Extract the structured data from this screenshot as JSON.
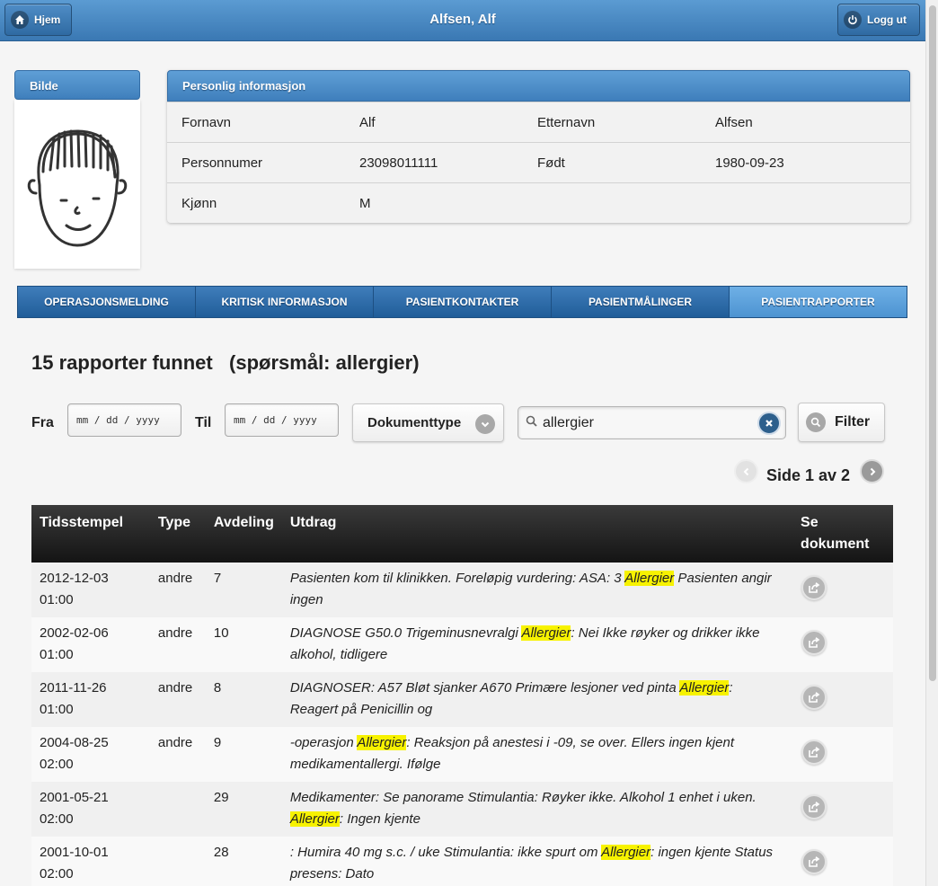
{
  "header": {
    "home_label": "Hjem",
    "title": "Alfsen, Alf",
    "logout_label": "Logg ut"
  },
  "photo_panel": {
    "title": "Bilde"
  },
  "info_panel": {
    "title": "Personlig informasjon",
    "rows": [
      [
        "Fornavn",
        "Alf",
        "Etternavn",
        "Alfsen"
      ],
      [
        "Personnumer",
        "23098011111",
        "Født",
        "1980-09-23"
      ],
      [
        "Kjønn",
        "M",
        "",
        ""
      ]
    ]
  },
  "tabs": [
    {
      "label": "OPERASJONSMELDING",
      "active": false
    },
    {
      "label": "KRITISK INFORMASJON",
      "active": false
    },
    {
      "label": "PASIENTKONTAKTER",
      "active": false
    },
    {
      "label": "PASIENTMÅLINGER",
      "active": false
    },
    {
      "label": "PASIENTRAPPORTER",
      "active": true
    }
  ],
  "results_title": "15 rapporter funnet   (spørsmål: allergier)",
  "filters": {
    "from_label": "Fra",
    "from_value": "mm / dd / yyyy",
    "to_label": "Til",
    "to_value": "mm / dd / yyyy",
    "doctype_label": "Dokumenttype",
    "search_value": "allergier",
    "filter_label": "Filter"
  },
  "pager": {
    "text": "Side 1 av 2"
  },
  "table": {
    "headers": [
      "Tidsstempel",
      "Type",
      "Avdeling",
      "Utdrag",
      "Se dokument"
    ],
    "highlight": "Allergier",
    "rows": [
      {
        "date": "2012-12-03",
        "time": "01:00",
        "type": "andre",
        "dept": "7",
        "pre": "Pasienten kom til klinikken. Foreløpig vurdering: ASA: 3 ",
        "post": " Pasienten angir ingen"
      },
      {
        "date": "2002-02-06",
        "time": "01:00",
        "type": "andre",
        "dept": "10",
        "pre": "DIAGNOSE G50.0 Trigeminusnevralgi ",
        "post": ": Nei Ikke røyker og drikker ikke alkohol, tidligere"
      },
      {
        "date": "2011-11-26",
        "time": "01:00",
        "type": "andre",
        "dept": "8",
        "pre": "DIAGNOSER: A57 Bløt sjanker A670 Primære lesjoner ved pinta ",
        "post": ": Reagert på Penicillin og"
      },
      {
        "date": "2004-08-25",
        "time": "02:00",
        "type": "andre",
        "dept": "9",
        "pre": "-operasjon ",
        "post": ": Reaksjon på anestesi i -09, se over. Ellers ingen kjent medikamentallergi. Ifølge"
      },
      {
        "date": "2001-05-21",
        "time": "02:00",
        "type": "",
        "dept": "29",
        "pre": "Medikamenter: Se panorame Stimulantia: Røyker ikke. Alkohol 1 enhet i uken. ",
        "post": ": Ingen kjente"
      },
      {
        "date": "2001-10-01",
        "time": "02:00",
        "type": "",
        "dept": "28",
        "pre": ": Humira 40 mg s.c. / uke Stimulantia: ikke spurt om ",
        "post": ": ingen kjente Status presens: Dato"
      }
    ]
  }
}
